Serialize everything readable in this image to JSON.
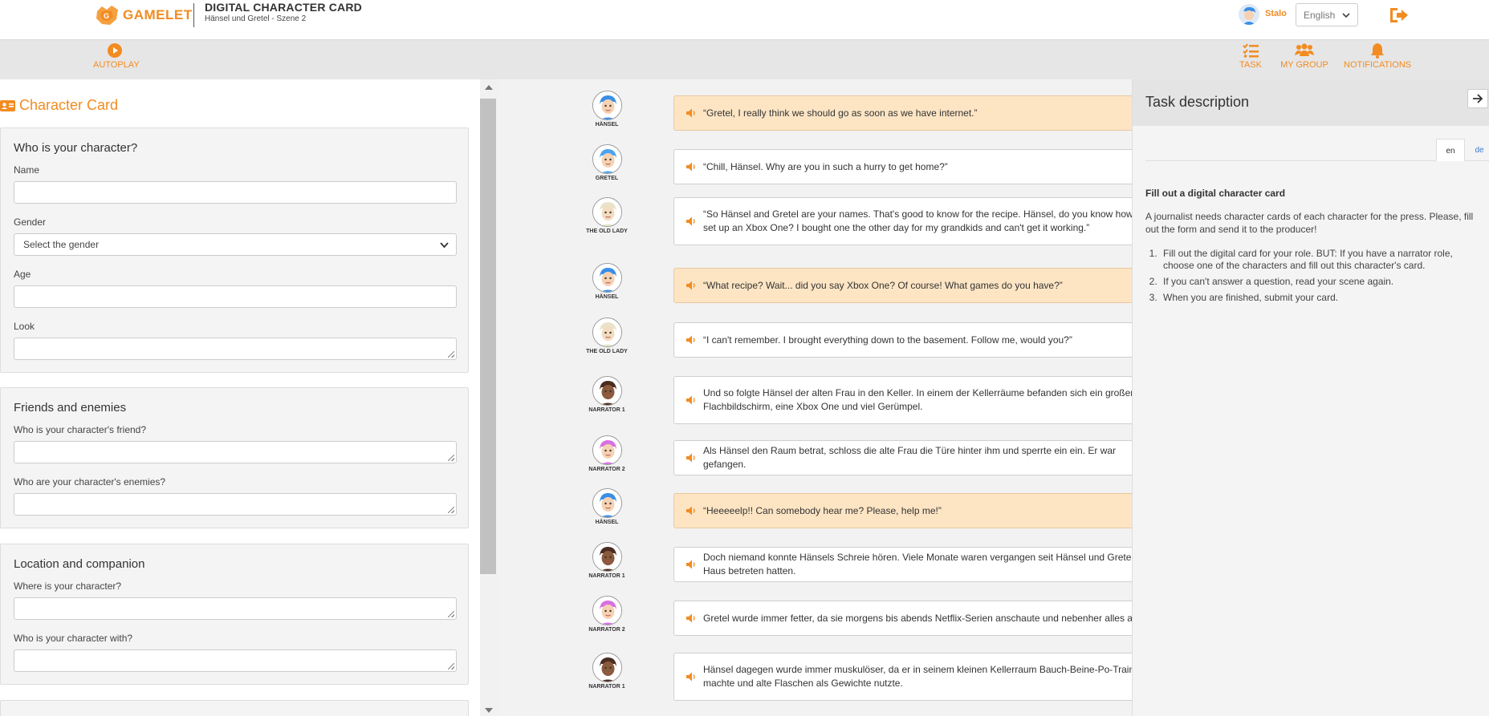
{
  "header": {
    "brand": "GAMELET",
    "app_title": "DIGITAL CHARACTER CARD",
    "subtitle": "Hänsel und Gretel - Szene 2",
    "user_name": "Stalo",
    "language": "English",
    "brand_color": "#f28c22"
  },
  "toolbar": {
    "autoplay": "AUTOPLAY",
    "task": "TASK",
    "my_group": "MY GROUP",
    "notifications": "NOTIFICATIONS"
  },
  "card": {
    "title": "Character Card",
    "sections": [
      {
        "heading": "Who is your character?",
        "fields": [
          {
            "label": "Name",
            "value": ""
          },
          {
            "label": "Gender",
            "value": "Select the gender"
          },
          {
            "label": "Age",
            "value": ""
          },
          {
            "label": "Look",
            "value": ""
          }
        ]
      },
      {
        "heading": "Friends and enemies",
        "fields": [
          {
            "label": "Who is your character's friend?",
            "value": ""
          },
          {
            "label": "Who are your character's enemies?",
            "value": ""
          }
        ]
      },
      {
        "heading": "Location and companion",
        "fields": [
          {
            "label": "Where is your character?",
            "value": ""
          },
          {
            "label": "Who is your character with?",
            "value": ""
          }
        ]
      }
    ]
  },
  "dialogue": [
    {
      "speaker": "HÄNSEL",
      "avatar": "hansel",
      "text": "“Gretel, I really think we should go as soon as we have internet.”",
      "highlight": true
    },
    {
      "speaker": "GRETEL",
      "avatar": "gretel",
      "text": "“Chill, Hänsel. Why are you in such a hurry to get home?”",
      "highlight": false
    },
    {
      "speaker": "THE OLD LADY",
      "avatar": "lady",
      "text": "“So Hänsel and Gretel are your names. That's good to know for the recipe. Hänsel, do you know how to set up an Xbox One? I bought one the other day for my grandkids and can't get it working.”",
      "highlight": false
    },
    {
      "speaker": "HÄNSEL",
      "avatar": "hansel",
      "text": "“What recipe? Wait... did you say Xbox One? Of course! What games do you have?”",
      "highlight": true
    },
    {
      "speaker": "THE OLD LADY",
      "avatar": "lady",
      "text": "“I can't remember. I brought everything down to the basement. Follow me, would you?”",
      "highlight": false
    },
    {
      "speaker": "NARRATOR 1",
      "avatar": "narrator1",
      "text": "Und so folgte Hänsel der alten Frau in den Keller. In einem der Kellerräume befanden sich ein großer Flachbildschirm, eine Xbox One und viel Gerümpel.",
      "highlight": false
    },
    {
      "speaker": "NARRATOR 2",
      "avatar": "narrator2",
      "text": "Als Hänsel den Raum betrat, schloss die alte Frau die Türe hinter ihm und sperrte ein ein. Er war gefangen.",
      "highlight": false
    },
    {
      "speaker": "HÄNSEL",
      "avatar": "hansel",
      "text": "“Heeeeelp!! Can somebody hear me? Please, help me!”",
      "highlight": true
    },
    {
      "speaker": "NARRATOR 1",
      "avatar": "narrator1",
      "text": "Doch niemand konnte Hänsels Schreie hören. Viele Monate waren vergangen seit Hänsel und Gretel das Haus betreten hatten.",
      "highlight": false
    },
    {
      "speaker": "NARRATOR 2",
      "avatar": "narrator2",
      "text": "Gretel wurde immer fetter, da sie morgens bis abends Netflix-Serien anschaute und nebenher alles aß.",
      "highlight": false
    },
    {
      "speaker": "NARRATOR 1",
      "avatar": "narrator1",
      "text": "Hänsel dagegen wurde immer muskulöser, da er in seinem kleinen Kellerraum Bauch-Beine-Po-Training machte und alte Flaschen als Gewichte nutzte.",
      "highlight": false
    }
  ],
  "task": {
    "title": "Task description",
    "tabs": [
      "en",
      "de"
    ],
    "heading": "Fill out a digital character card",
    "intro": "A journalist needs character cards of each character for the press. Please, fill out the form and send it to the producer!",
    "steps": [
      "Fill out the digital card for your role. BUT: If you have a narrator role, choose one of the characters and fill out this character's card.",
      "If you can't answer a question, read your scene again.",
      "When you are finished, submit your card."
    ]
  }
}
